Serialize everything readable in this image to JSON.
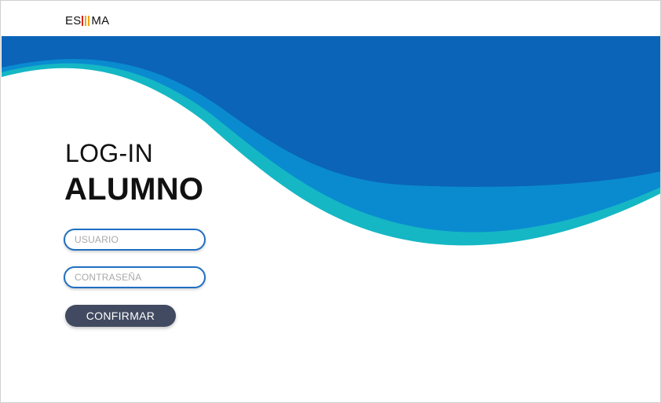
{
  "brand": {
    "logo_prefix": "ES",
    "logo_suffix": "MA",
    "logo_bar_colors": [
      "#e0211b",
      "#f0a51a",
      "#f0a51a"
    ]
  },
  "colors": {
    "wave_dark": "#0b64b8",
    "wave_mid": "#0a8bd0",
    "wave_teal": "#15b7c4",
    "button_bg": "#414a60",
    "input_border": "#1f6fc2"
  },
  "login": {
    "title_light": "LOG-IN",
    "title_bold": "ALUMNO",
    "username_placeholder": "USUARIO",
    "password_placeholder": "CONTRASEÑA",
    "confirm_label": "CONFIRMAR"
  }
}
